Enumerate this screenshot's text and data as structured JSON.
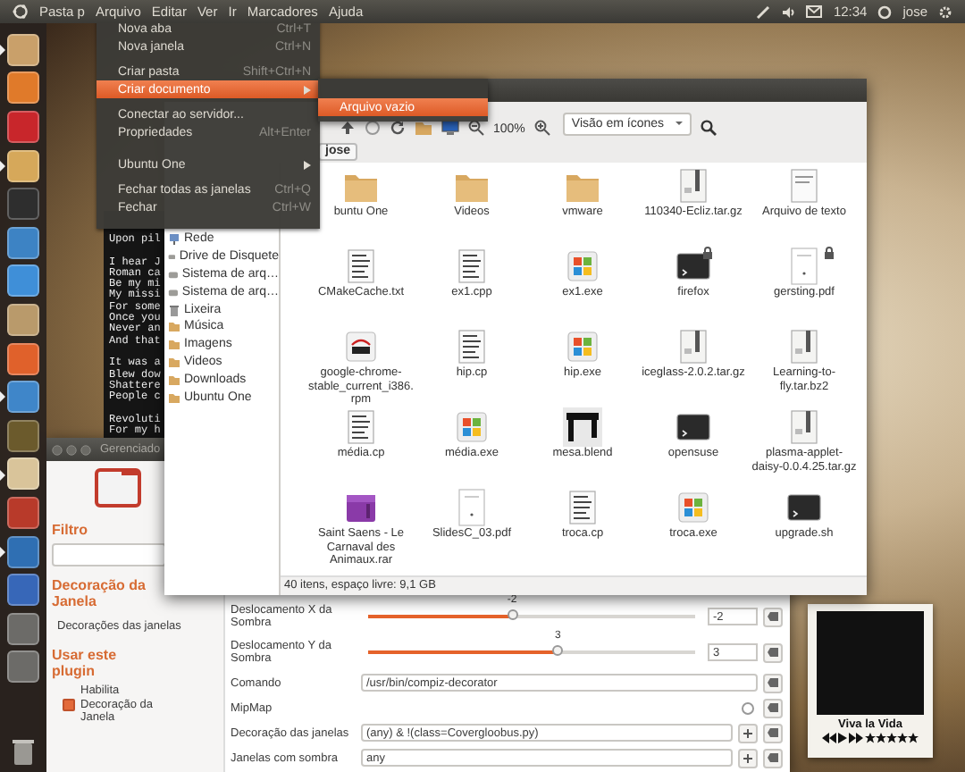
{
  "top_panel": {
    "app_title": "Pasta p",
    "menus": [
      "Arquivo",
      "Editar",
      "Ver",
      "Ir",
      "Marcadores",
      "Ajuda"
    ],
    "clock": "12:34",
    "user": "jose"
  },
  "launcher": [
    {
      "color": "#c9a06a",
      "running": true
    },
    {
      "color": "#e07a2a",
      "running": false
    },
    {
      "color": "#c8262b",
      "running": false
    },
    {
      "color": "#d6a85a",
      "running": true
    },
    {
      "color": "#2e2e2e",
      "running": false
    },
    {
      "color": "#3d83c4",
      "running": false
    },
    {
      "color": "#3f8fd8",
      "running": false
    },
    {
      "color": "#b99a6b",
      "running": false
    },
    {
      "color": "#e0612b",
      "running": false
    },
    {
      "color": "#3f86c9",
      "running": true
    },
    {
      "color": "#6b5a2c",
      "running": false
    },
    {
      "color": "#d9c49a",
      "running": true
    },
    {
      "color": "#b83a2a",
      "running": false
    },
    {
      "color": "#2f6fb3",
      "running": true
    },
    {
      "color": "#3767b8",
      "running": false
    },
    {
      "color": "#6c6b68",
      "running": false
    },
    {
      "color": "#6c6b68",
      "running": false
    }
  ],
  "file_menu": {
    "items": [
      {
        "kind": "item",
        "label": "Nova aba",
        "shortcut": "Ctrl+T",
        "submenu": false,
        "selected": false
      },
      {
        "kind": "item",
        "label": "Nova janela",
        "shortcut": "Ctrl+N",
        "submenu": false,
        "selected": false
      },
      {
        "kind": "separator"
      },
      {
        "kind": "item",
        "label": "Criar pasta",
        "shortcut": "Shift+Ctrl+N",
        "submenu": false,
        "selected": false
      },
      {
        "kind": "item",
        "label": "Criar documento",
        "submenu": true,
        "selected": true
      },
      {
        "kind": "separator"
      },
      {
        "kind": "item",
        "label": "Conectar ao servidor...",
        "submenu": false,
        "selected": false
      },
      {
        "kind": "item",
        "label": "Propriedades",
        "shortcut": "Alt+Enter",
        "submenu": false,
        "selected": false
      },
      {
        "kind": "separator"
      },
      {
        "kind": "separator"
      },
      {
        "kind": "item",
        "label": "Ubuntu One",
        "submenu": true,
        "selected": false
      },
      {
        "kind": "separator"
      },
      {
        "kind": "item",
        "label": "Fechar todas as janelas",
        "shortcut": "Ctrl+Q",
        "submenu": false,
        "selected": false
      },
      {
        "kind": "item",
        "label": "Fechar",
        "shortcut": "Ctrl+W",
        "submenu": false,
        "selected": false
      }
    ],
    "submenu": [
      {
        "label": "Arquivo vazio",
        "selected": true
      }
    ]
  },
  "terminal": {
    "paragraphs": [
      [
        "Upon pil"
      ],
      [
        "I hear J",
        "Roman ca",
        "Be my mi",
        "My missi",
        "For some",
        "Once you",
        "Never an",
        "And that"
      ],
      [
        "It was a",
        "Blew dow",
        "Shattere",
        "People c"
      ],
      [
        "Revoluti",
        "For my h"
      ]
    ]
  },
  "file_window": {
    "zoom": "100%",
    "view": "Visão em ícones",
    "path": "jose",
    "sidebar": [
      {
        "kind": "network",
        "label": "Rede"
      },
      {
        "kind": "drive",
        "label": "Drive de Disquete"
      },
      {
        "kind": "drive",
        "label": "Sistema de arq…"
      },
      {
        "kind": "drive",
        "label": "Sistema de arq…"
      },
      {
        "kind": "trash",
        "label": "Lixeira"
      },
      {
        "kind": "folder",
        "label": "Música"
      },
      {
        "kind": "folder",
        "label": "Imagens"
      },
      {
        "kind": "folder",
        "label": "Videos"
      },
      {
        "kind": "folder",
        "label": "Downloads"
      },
      {
        "kind": "folder",
        "label": "Ubuntu One"
      }
    ],
    "files": [
      {
        "kind": "folder",
        "name": "buntu One",
        "locked": false
      },
      {
        "kind": "folder",
        "name": "Videos",
        "locked": false
      },
      {
        "kind": "folder",
        "name": "vmware",
        "locked": false
      },
      {
        "kind": "archive",
        "name": "110340-Ecliz.tar.gz",
        "locked": false
      },
      {
        "kind": "text",
        "name": "Arquivo de texto",
        "locked": false
      },
      {
        "kind": "code",
        "name": "CMakeCache.txt",
        "locked": false
      },
      {
        "kind": "code",
        "name": "ex1.cpp",
        "locked": false
      },
      {
        "kind": "exe",
        "name": "ex1.exe",
        "locked": false
      },
      {
        "kind": "terminal",
        "name": "firefox",
        "locked": true
      },
      {
        "kind": "pdf",
        "name": "gersting.pdf",
        "locked": true
      },
      {
        "kind": "rpm",
        "name": "google-chrome-stable_current_i386.rpm",
        "locked": false
      },
      {
        "kind": "code",
        "name": "hip.cp",
        "locked": false
      },
      {
        "kind": "exe",
        "name": "hip.exe",
        "locked": false
      },
      {
        "kind": "archive",
        "name": "iceglass-2.0.2.tar.gz",
        "locked": false
      },
      {
        "kind": "archive",
        "name": "Learning-to-fly.tar.bz2",
        "locked": false
      },
      {
        "kind": "code",
        "name": "média.cp",
        "locked": false
      },
      {
        "kind": "exe",
        "name": "média.exe",
        "locked": false
      },
      {
        "kind": "image",
        "name": "mesa.blend",
        "locked": false
      },
      {
        "kind": "terminal",
        "name": "opensuse",
        "locked": false
      },
      {
        "kind": "archive",
        "name": "plasma-applet-daisy-0.0.4.25.tar.gz",
        "locked": false
      },
      {
        "kind": "rar",
        "name": "Saint Saens - Le Carnaval des Animaux.rar",
        "locked": false
      },
      {
        "kind": "pdf",
        "name": "SlidesC_03.pdf",
        "locked": false
      },
      {
        "kind": "code",
        "name": "troca.cp",
        "locked": false
      },
      {
        "kind": "exe",
        "name": "troca.exe",
        "locked": false
      },
      {
        "kind": "terminal",
        "name": "upgrade.sh",
        "locked": false
      }
    ],
    "status": "40 itens, espaço livre: 9,1 GB"
  },
  "settings_window": {
    "title": "Gerenciado",
    "filter_label": "Filtro",
    "plugin_title": "Decoração da Janela",
    "section": "Decorações das janelas",
    "use_plugin_label": "Usar este plugin",
    "enable": {
      "label": "Habilita Decoração da Janela",
      "checked": true
    },
    "options": [
      {
        "kind": "slider",
        "label": "Deslocamento X da Sombra",
        "level": 0.44,
        "reading": "-2",
        "value": "-2"
      },
      {
        "kind": "slider",
        "label": "Deslocamento Y da Sombra",
        "level": 0.58,
        "reading": "3",
        "value": "3"
      },
      {
        "kind": "text",
        "label": "Comando",
        "value": "/usr/bin/compiz-decorator"
      },
      {
        "kind": "checkbox",
        "label": "MipMap",
        "checked": false
      },
      {
        "kind": "match",
        "label": "Decoração das janelas",
        "value": "(any) & !(class=Covergloobus.py)"
      },
      {
        "kind": "match",
        "label": "Janelas com sombra",
        "value": "any"
      }
    ]
  },
  "music_widget": {
    "title": "Viva la Vida",
    "stars": 5
  }
}
